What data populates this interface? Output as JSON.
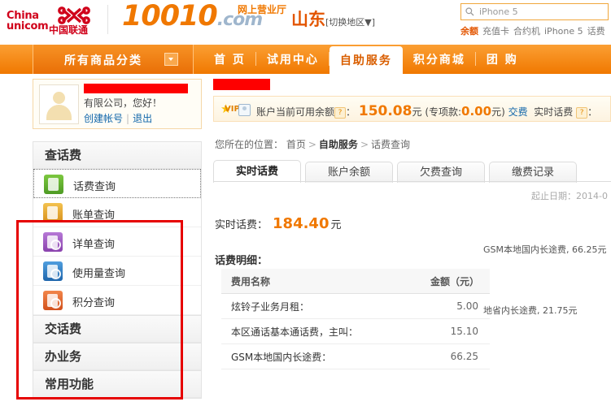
{
  "header": {
    "logo_line1": "China",
    "logo_line2": "unicom",
    "logo_cn": "中国联通",
    "brand_number": "10010",
    "brand_domain": ".com",
    "brand_sub": "网上营业厅",
    "region_name": "山东",
    "region_switch": "[切换地区▼]",
    "search_placeholder": "iPhone 5",
    "hotwords": [
      "余额",
      "充值卡",
      "合约机",
      "iPhone 5",
      "话费"
    ]
  },
  "nav": {
    "category_label": "所有商品分类",
    "items": [
      {
        "label": "首 页",
        "active": false
      },
      {
        "label": "试用中心",
        "active": false
      },
      {
        "label": "自助服务",
        "active": true
      },
      {
        "label": "积分商城",
        "active": false
      },
      {
        "label": "团 购",
        "active": false
      }
    ]
  },
  "user_card": {
    "greeting": "有限公司，您好！",
    "create_account": "创建帐号",
    "logout": "退出"
  },
  "balance_bar": {
    "vip_label": "VIP",
    "balance_label": "账户当前可用余额",
    "help": "?",
    "colon": "：",
    "balance_value": "150.08",
    "unit": "元",
    "special_prefix": "(专项款:",
    "special_value": "0.00",
    "special_suffix": "元)",
    "pay_link": "交费",
    "realtime_label": "实时话费",
    "realtime_help": "?",
    "realtime_colon": "："
  },
  "sidebar": {
    "sections": [
      {
        "title": "查话费",
        "items": [
          {
            "label": "话费查询",
            "icon": "phone-fee-icon",
            "color": "#5fae2e",
            "selected": true
          },
          {
            "label": "账单查询",
            "icon": "bill-icon",
            "color": "#e0a128",
            "selected": false
          },
          {
            "label": "详单查询",
            "icon": "detail-search-icon",
            "color": "#9b59b6",
            "selected": false
          },
          {
            "label": "使用量查询",
            "icon": "usage-search-icon",
            "color": "#2e7ec4",
            "selected": false
          },
          {
            "label": "积分查询",
            "icon": "points-search-icon",
            "color": "#e0622a",
            "selected": false
          }
        ]
      },
      {
        "title": "交话费",
        "items": []
      },
      {
        "title": "办业务",
        "items": []
      },
      {
        "title": "常用功能",
        "items": []
      }
    ]
  },
  "breadcrumb": {
    "prefix": "您所在的位置：",
    "home": "首页",
    "sep": ">",
    "section": "自助服务",
    "current": "话费查询"
  },
  "tabs": [
    {
      "label": "实时话费",
      "active": true
    },
    {
      "label": "账户余额",
      "active": false
    },
    {
      "label": "欠费查询",
      "active": false
    },
    {
      "label": "缴费记录",
      "active": false
    }
  ],
  "content": {
    "date_range": "起止日期：2014-0",
    "realtime_fee_label": "实时话费：",
    "realtime_fee_value": "184.40",
    "realtime_fee_unit": "元",
    "detail_title": "话费明细：",
    "table": {
      "headers": [
        "费用名称",
        "金额（元）"
      ],
      "rows": [
        {
          "name": "炫铃子业务月租：",
          "amount": "5.00"
        },
        {
          "name": "本区通话基本通话费，主叫：",
          "amount": "15.10"
        },
        {
          "name": "GSM本地国内长途费：",
          "amount": "66.25"
        }
      ]
    },
    "chart_labels": [
      {
        "text": "GSM本地国内长途费, 66.25元"
      },
      {
        "text": "地省内长途费, 21.75元"
      }
    ]
  },
  "colors": {
    "brand_orange": "#f07800",
    "accent_red": "#d0021b",
    "annotation_red": "#e60000",
    "link_blue": "#1166aa"
  }
}
